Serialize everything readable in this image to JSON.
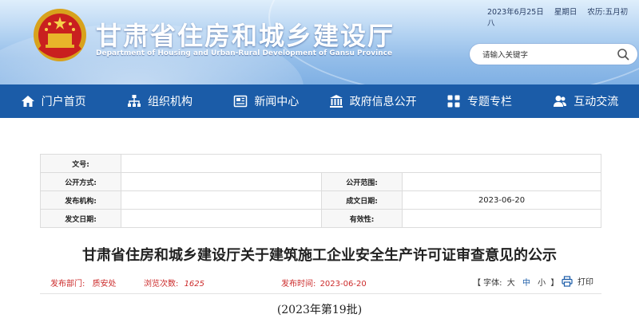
{
  "header": {
    "title_cn": "甘肃省住房和城乡建设厅",
    "title_en": "Department of Housing and Urban-Rural Development of Gansu Province",
    "date": "2023年6月25日",
    "weekday": "星期日",
    "lunar": "农历:五月初八",
    "search_placeholder": "请输入关键字"
  },
  "nav": [
    {
      "label": "门户首页",
      "icon": "home-icon"
    },
    {
      "label": "组织机构",
      "icon": "org-chart-icon"
    },
    {
      "label": "新闻中心",
      "icon": "newspaper-icon"
    },
    {
      "label": "政府信息公开",
      "icon": "government-building-icon"
    },
    {
      "label": "专题专栏",
      "icon": "grid-icon"
    },
    {
      "label": "互动交流",
      "icon": "users-icon"
    }
  ],
  "meta": {
    "wenhao_label": "文号:",
    "wenhao_value": "",
    "gongkai_fangshi_label": "公开方式:",
    "gongkai_fangshi_value": "",
    "gongkai_fanwei_label": "公开范围:",
    "gongkai_fanwei_value": "",
    "fabu_jigou_label": "发布机构:",
    "fabu_jigou_value": "",
    "chengwen_riqi_label": "成文日期:",
    "chengwen_riqi_value": "2023-06-20",
    "fawen_riqi_label": "发文日期:",
    "fawen_riqi_value": "",
    "youxiaoxing_label": "有效性:",
    "youxiaoxing_value": ""
  },
  "article": {
    "title": "甘肃省住房和城乡建设厅关于建筑施工企业安全生产许可证审查意见的公示",
    "dept_label": "发布部门:",
    "dept_value": "质安处",
    "views_label": "浏览次数:",
    "views_value": "1625",
    "time_label": "发布时间:",
    "time_value": "2023-06-20",
    "fontsize_label": "【 字体:",
    "font_big": "大",
    "font_mid": "中",
    "font_small": "小",
    "fontsize_end": "】",
    "print_label": "打印",
    "batch": "(2023年第19批)"
  },
  "colors": {
    "nav_bg": "#1b5ca8",
    "accent_red": "#cc2b2b"
  }
}
